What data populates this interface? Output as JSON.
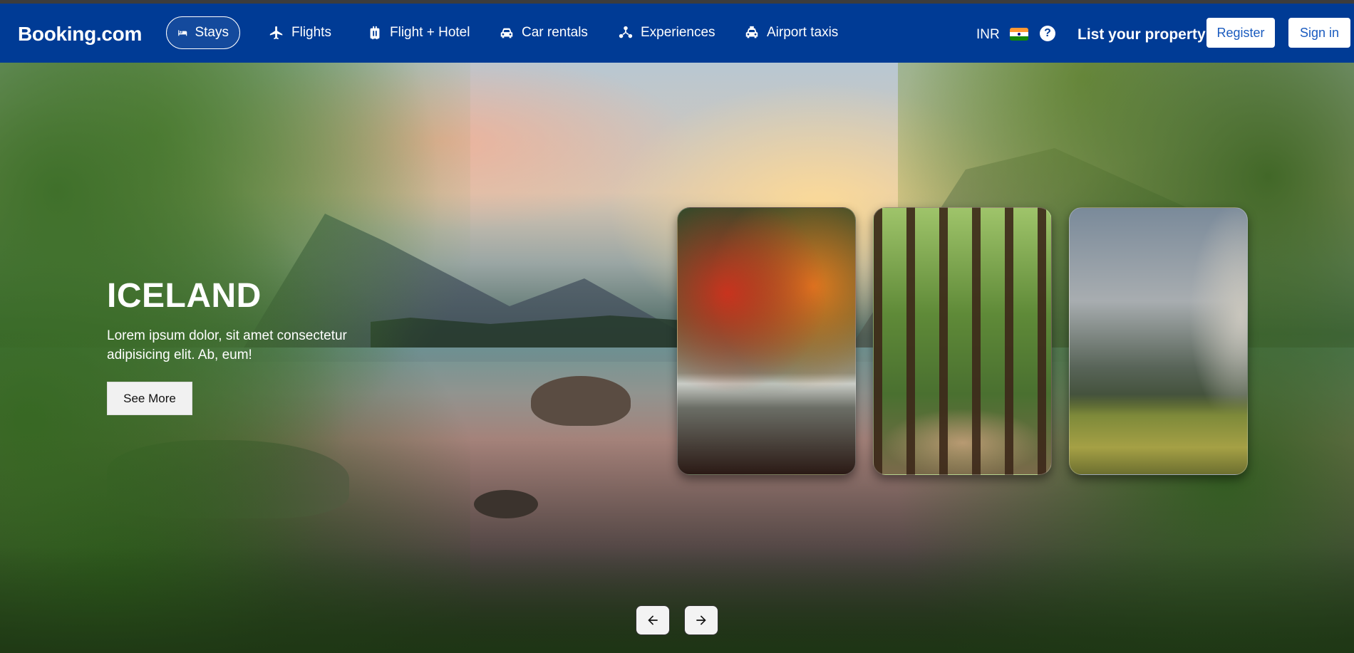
{
  "header": {
    "brand": "Booking.com",
    "nav": [
      {
        "label": "Stays",
        "icon": "bed-icon",
        "active": true
      },
      {
        "label": "Flights",
        "icon": "plane-icon"
      },
      {
        "label": "Flight + Hotel",
        "icon": "luggage-icon"
      },
      {
        "label": "Car rentals",
        "icon": "car-icon"
      },
      {
        "label": "Experiences",
        "icon": "attractions-icon"
      },
      {
        "label": "Airport taxis",
        "icon": "taxi-icon"
      }
    ],
    "currency": "INR",
    "flag": "india-flag-icon",
    "help_glyph": "?",
    "list_property": "List your property",
    "register": "Register",
    "sign_in": "Sign in"
  },
  "hero": {
    "title": "ICELAND",
    "description": "Lorem ipsum dolor, sit amet consectetur adipisicing elit. Ab, eum!",
    "cta": "See More",
    "cards": [
      "autumn-lake-card",
      "forest-path-card",
      "cliff-valley-card"
    ]
  },
  "carousel": {
    "prev_glyph": "←",
    "next_glyph": "→"
  },
  "colors": {
    "brand_blue": "#003b95",
    "button_text_blue": "#1a5bbf"
  }
}
